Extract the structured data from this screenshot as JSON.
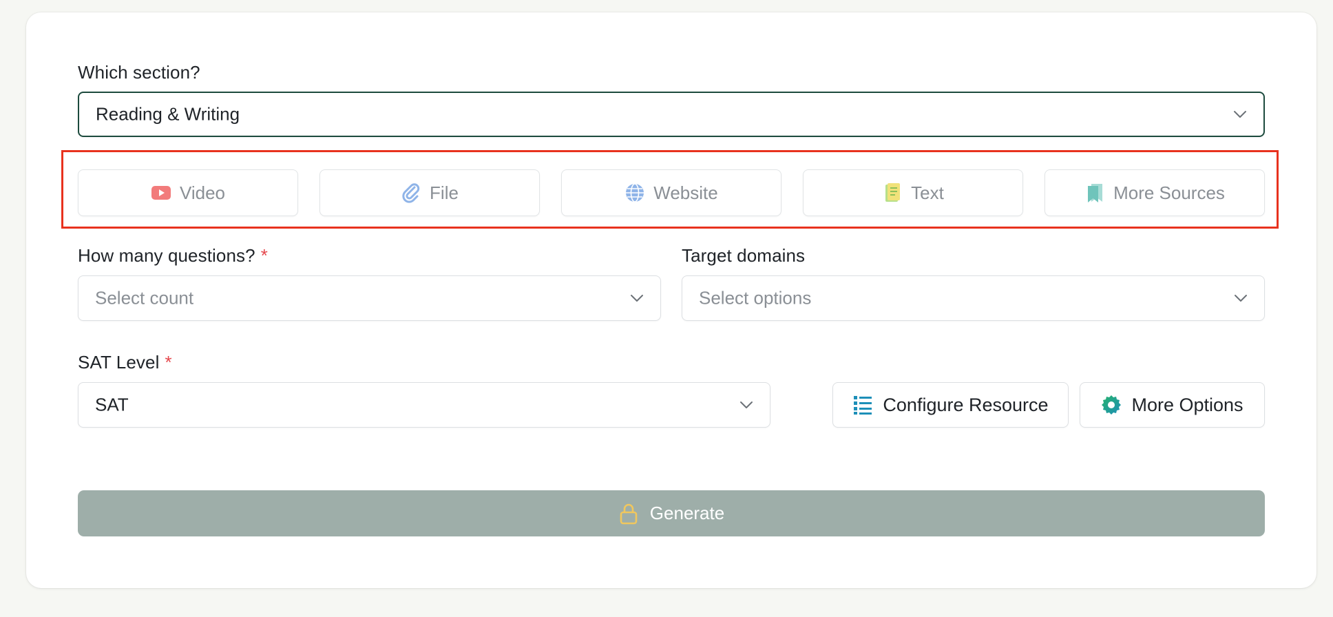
{
  "section": {
    "label": "Which section?",
    "value": "Reading & Writing",
    "icon": "chevron-down-icon"
  },
  "sources": [
    {
      "label": "Video",
      "icon": "video-icon"
    },
    {
      "label": "File",
      "icon": "paperclip-icon"
    },
    {
      "label": "Website",
      "icon": "globe-icon"
    },
    {
      "label": "Text",
      "icon": "text-doc-icon"
    },
    {
      "label": "More Sources",
      "icon": "bookmark-icon"
    }
  ],
  "questions": {
    "label": "How many questions?",
    "required_mark": "*",
    "placeholder": "Select count"
  },
  "domains": {
    "label": "Target domains",
    "placeholder": "Select options"
  },
  "level": {
    "label": "SAT Level",
    "required_mark": "*",
    "value": "SAT"
  },
  "actions": {
    "configure_label": "Configure Resource",
    "more_options_label": "More Options"
  },
  "generate": {
    "label": "Generate",
    "icon": "lock-icon",
    "disabled": true
  },
  "colors": {
    "accent": "#1c4a3d",
    "required": "#e5484d",
    "highlight": "#e8321e",
    "generate_bg": "#9eaea9"
  }
}
